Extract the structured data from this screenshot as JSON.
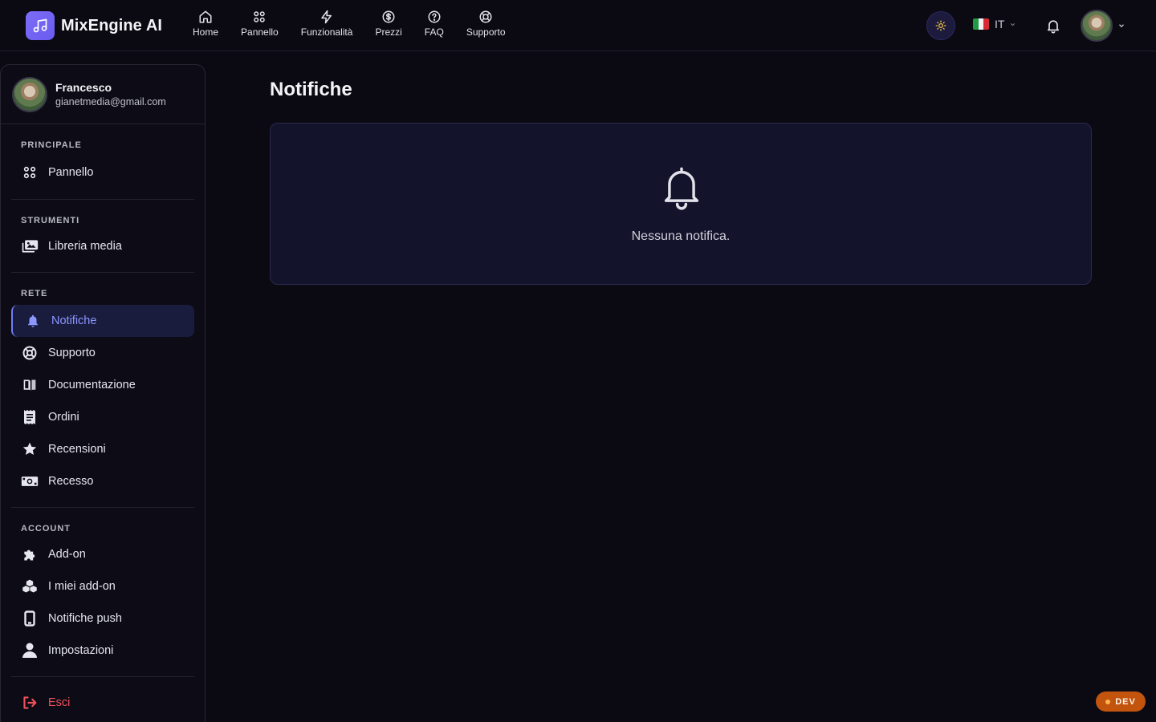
{
  "brand": {
    "name": "MixEngine AI",
    "logo_icon": "music-note-icon",
    "accent": "#7c6cf6"
  },
  "nav": [
    {
      "label": "Home",
      "icon": "home-icon"
    },
    {
      "label": "Pannello",
      "icon": "grid-icon"
    },
    {
      "label": "Funzionalità",
      "icon": "bolt-icon"
    },
    {
      "label": "Prezzi",
      "icon": "dollar-icon"
    },
    {
      "label": "FAQ",
      "icon": "question-icon"
    },
    {
      "label": "Supporto",
      "icon": "lifebuoy-icon"
    }
  ],
  "header": {
    "theme_icon": "sun-icon",
    "language": {
      "code": "IT",
      "flag": "italy-flag"
    },
    "notifications_icon": "bell-icon"
  },
  "user": {
    "name": "Francesco",
    "email": "gianetmedia@gmail.com"
  },
  "sidebar": {
    "sections": [
      {
        "title": "PRINCIPALE",
        "items": [
          {
            "label": "Pannello",
            "icon": "grid-icon"
          }
        ]
      },
      {
        "title": "STRUMENTI",
        "items": [
          {
            "label": "Libreria media",
            "icon": "photo-library-icon"
          }
        ]
      },
      {
        "title": "RETE",
        "items": [
          {
            "label": "Notifiche",
            "icon": "bell-icon",
            "active": true
          },
          {
            "label": "Supporto",
            "icon": "lifebuoy-icon"
          },
          {
            "label": "Documentazione",
            "icon": "book-icon"
          },
          {
            "label": "Ordini",
            "icon": "receipt-icon"
          },
          {
            "label": "Recensioni",
            "icon": "star-icon"
          },
          {
            "label": "Recesso",
            "icon": "money-bill-icon"
          }
        ]
      },
      {
        "title": "ACCOUNT",
        "items": [
          {
            "label": "Add-on",
            "icon": "puzzle-icon"
          },
          {
            "label": "I miei add-on",
            "icon": "cubes-icon"
          },
          {
            "label": "Notifiche push",
            "icon": "mobile-icon"
          },
          {
            "label": "Impostazioni",
            "icon": "user-icon"
          }
        ]
      }
    ],
    "logout": {
      "label": "Esci",
      "icon": "sign-out-icon",
      "color": "#f0505a"
    }
  },
  "main": {
    "title": "Notifiche",
    "empty_state": {
      "text": "Nessuna notifica.",
      "icon": "bell-outline-icon"
    }
  },
  "dev_badge": {
    "label": "DEV",
    "color": "#c2540e"
  }
}
